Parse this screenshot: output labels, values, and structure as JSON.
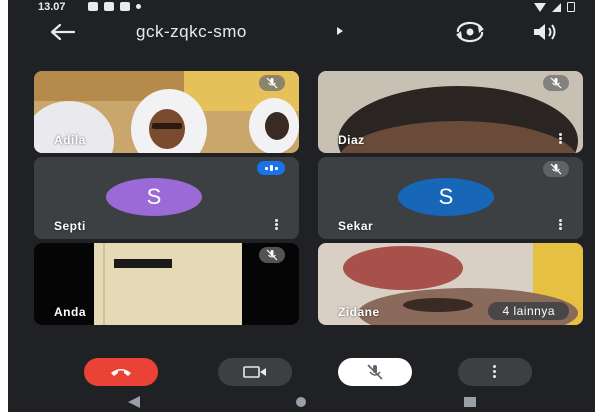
{
  "status_bar": {
    "time": "13.07"
  },
  "top_bar": {
    "meeting_code": "gck-zqkc-smo"
  },
  "participants": [
    {
      "name": "Adila",
      "type": "video",
      "muted": true
    },
    {
      "name": "Diaz",
      "type": "video",
      "muted": true
    },
    {
      "name": "Septi",
      "type": "avatar",
      "initial": "S",
      "avatar_color": "#9c6ad6",
      "speaking": true
    },
    {
      "name": "Sekar",
      "type": "avatar",
      "initial": "S",
      "avatar_color": "#1766b8",
      "muted": true
    },
    {
      "name": "Anda",
      "type": "video",
      "muted": true
    },
    {
      "name": "Zidane",
      "type": "video"
    }
  ],
  "more_participants_label": "4 lainnya",
  "controls": {
    "end_call_color": "#ea4335",
    "camera_bg": "#3c4043",
    "mic_bg": "#ffffff",
    "more_bg": "#3c4043"
  },
  "icons": {
    "back": "arrow-back-icon",
    "switch_camera": "switch-camera-icon",
    "speaker": "speaker-icon",
    "mic_off": "mic-off-icon",
    "more": "more-vert-icon",
    "end_call": "call-end-icon",
    "camera": "videocam-icon"
  }
}
